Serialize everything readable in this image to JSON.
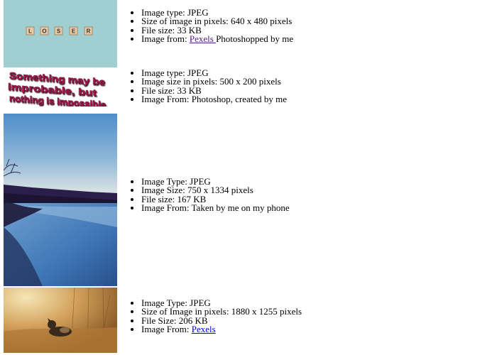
{
  "items": [
    {
      "lines": [
        "Image type: JPEG",
        "Size of image in pixels: 640 x 480 pixels",
        "File size: 33 KB"
      ],
      "from_prefix": "Image from: ",
      "from_link": "Pexels ",
      "from_suffix": "Photoshopped by me",
      "tiles": [
        "L",
        "O",
        "S",
        "E",
        "R"
      ]
    },
    {
      "lines": [
        "Image type: JPEG",
        "Image size in pixels: 500 x 200 pixels",
        "File size: 33 KB",
        "Image From: Photoshop, created by me"
      ],
      "art_text": [
        "Something may be",
        "improbable, but",
        "nothing is impossible."
      ]
    },
    {
      "lines": [
        "Image Type: JPEG",
        "Image Size: 750 x 1334 pixels",
        "File size: 167 KB",
        "Image From: Taken by me on my phone"
      ]
    },
    {
      "lines": [
        "Image Type: JPEG",
        "Size of Image in pixels: 1880 x 1255 pixels",
        "File Size: 206 KB"
      ],
      "from_prefix": "Image From: ",
      "from_link": "Pexels"
    }
  ]
}
